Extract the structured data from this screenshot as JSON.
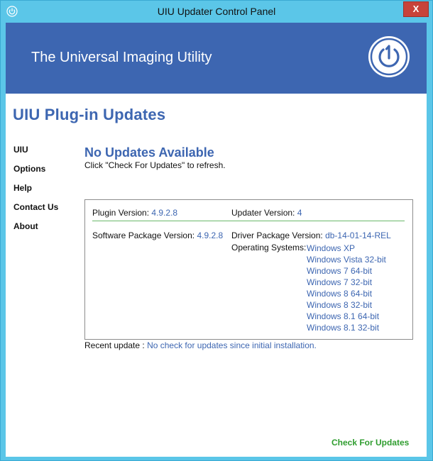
{
  "window": {
    "title": "UIU Updater Control Panel",
    "close_glyph": "X"
  },
  "banner": {
    "title": "The Universal Imaging Utility",
    "logo_icon": "power-one-icon"
  },
  "page": {
    "title": "UIU Plug-in Updates"
  },
  "nav": {
    "items": [
      {
        "label": "UIU"
      },
      {
        "label": "Options"
      },
      {
        "label": "Help"
      },
      {
        "label": "Contact Us"
      },
      {
        "label": "About"
      }
    ]
  },
  "status": {
    "title": "No Updates Available",
    "subtitle": "Click \"Check For Updates\" to refresh."
  },
  "info": {
    "plugin_version_label": "Plugin Version:",
    "plugin_version": "4.9.2.8",
    "updater_version_label": "Updater Version:",
    "updater_version": "4",
    "software_package_label": "Software Package Version:",
    "software_package": "4.9.2.8",
    "driver_package_label": "Driver Package Version:",
    "driver_package": "db-14-01-14-REL",
    "os_label": "Operating Systems:",
    "os_list": [
      "Windows XP",
      "Windows Vista 32-bit",
      "Windows 7 64-bit",
      "Windows 7 32-bit",
      "Windows 8 64-bit",
      "Windows 8 32-bit",
      "Windows 8.1 64-bit",
      "Windows 8.1 32-bit"
    ]
  },
  "recent": {
    "label": "Recent update :",
    "value": "No check for updates since initial installation."
  },
  "actions": {
    "check_label": "Check For Updates"
  },
  "colors": {
    "titlebar": "#5bc6e8",
    "banner": "#3d66b1",
    "accent_text": "#3d66b1",
    "action_green": "#2f9d2f",
    "close_red": "#c8433a"
  }
}
